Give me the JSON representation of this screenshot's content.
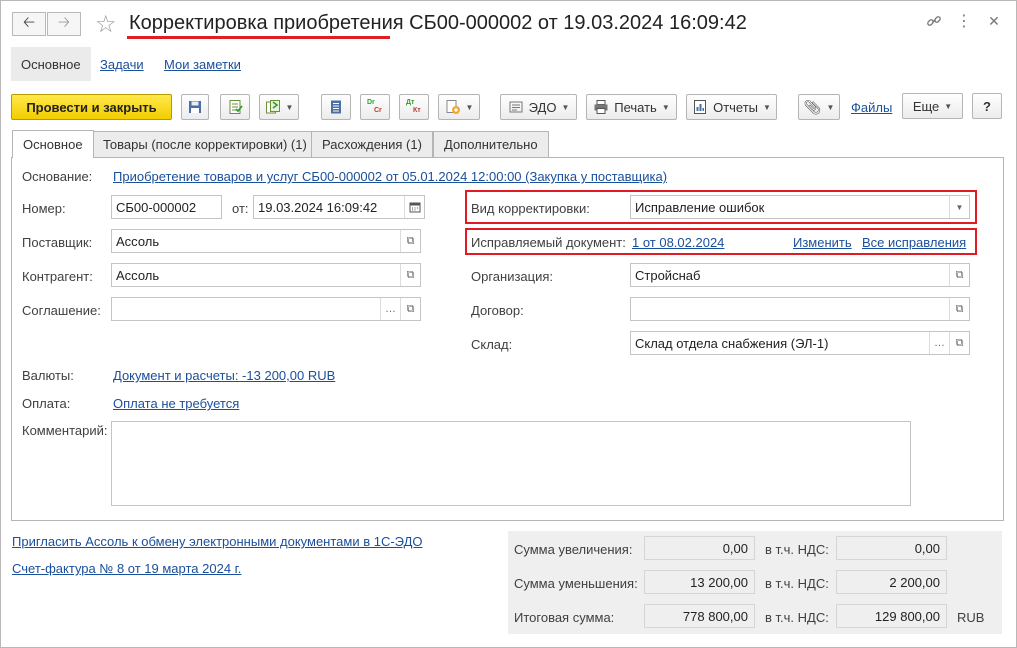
{
  "titlebar": {
    "back_icon": "arrow-left",
    "forward_icon": "arrow-right",
    "favorite_icon": "star",
    "title": "Корректировка приобретения СБ00-000002 от 19.03.2024 16:09:42",
    "link_icon": "link",
    "more_icon": "vertical-dots",
    "close_icon": "close"
  },
  "sections": {
    "main": "Основное",
    "tasks": "Задачи",
    "notes": "Мои заметки"
  },
  "toolbar": {
    "post_close": "Провести и закрыть",
    "edo": "ЭДО",
    "print": "Печать",
    "reports": "Отчеты",
    "files": "Файлы",
    "more": "Еще",
    "help": "?",
    "dt_label": "Dr",
    "cr_label": "Cr",
    "dt_ru": "Дт",
    "kt_ru": "Кт"
  },
  "tabs": [
    {
      "label": "Основное",
      "active": true
    },
    {
      "label": "Товары (после корректировки) (1)"
    },
    {
      "label": "Расхождения (1)"
    },
    {
      "label": "Дополнительно"
    }
  ],
  "form": {
    "basis_label": "Основание:",
    "basis_value": "Приобретение товаров и услуг СБ00-000002 от 05.01.2024 12:00:00 (Закупка у поставщика)",
    "number_label": "Номер:",
    "number_value": "СБ00-000002",
    "date_label": "от:",
    "date_value": "19.03.2024 16:09:42",
    "supplier_label": "Поставщик:",
    "supplier_value": "Ассоль",
    "counterparty_label": "Контрагент:",
    "counterparty_value": "Ассоль",
    "agreement_label": "Соглашение:",
    "agreement_value": "",
    "correction_type_label": "Вид корректировки:",
    "correction_type_value": "Исправление ошибок",
    "corrected_doc_label": "Исправляемый документ:",
    "corrected_doc_value": "1 от 08.02.2024",
    "change_link": "Изменить",
    "all_corrections_link": "Все исправления",
    "organization_label": "Организация:",
    "organization_value": "Стройснаб",
    "contract_label": "Договор:",
    "contract_value": "",
    "warehouse_label": "Склад:",
    "warehouse_value": "Склад отдела снабжения (ЭЛ-1)",
    "currencies_label": "Валюты:",
    "currencies_value": "Документ и расчеты: -13 200,00 RUB",
    "payment_label": "Оплата:",
    "payment_value": "Оплата не требуется",
    "comment_label": "Комментарий:",
    "comment_value": ""
  },
  "footer": {
    "invite_link": "Пригласить Ассоль к обмену электронными документами в 1С-ЭДО",
    "invoice_link": "Счет-фактура № 8 от 19 марта 2024 г."
  },
  "totals": {
    "increase_label": "Сумма увеличения:",
    "increase_value": "0,00",
    "increase_vat_label": "в т.ч. НДС:",
    "increase_vat_value": "0,00",
    "decrease_label": "Сумма уменьшения:",
    "decrease_value": "13 200,00",
    "decrease_vat_label": "в т.ч. НДС:",
    "decrease_vat_value": "2 200,00",
    "total_label": "Итоговая сумма:",
    "total_value": "778 800,00",
    "total_vat_label": "в т.ч. НДС:",
    "total_vat_value": "129 800,00",
    "currency": "RUB"
  },
  "colors": {
    "primary_button": "#f3cd00",
    "link": "#1a4f9c",
    "highlight": "#e01b24"
  }
}
